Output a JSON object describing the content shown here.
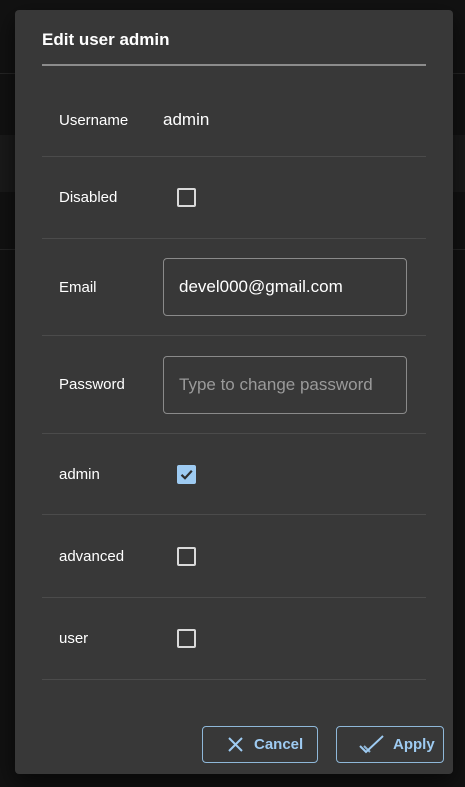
{
  "dialog": {
    "title": "Edit user admin",
    "username_label": "Username",
    "username_value": "admin",
    "disabled_label": "Disabled",
    "disabled_checked": false,
    "email_label": "Email",
    "email_value": "devel000@gmail.com",
    "password_label": "Password",
    "password_placeholder": "Type to change password",
    "roles": [
      {
        "label": "admin",
        "checked": true
      },
      {
        "label": "advanced",
        "checked": false
      },
      {
        "label": "user",
        "checked": false
      }
    ],
    "cancel_label": "Cancel",
    "apply_label": "Apply"
  },
  "colors": {
    "accent": "#9ecbf2",
    "dialog_bg": "#383838",
    "backdrop": "#121212"
  }
}
